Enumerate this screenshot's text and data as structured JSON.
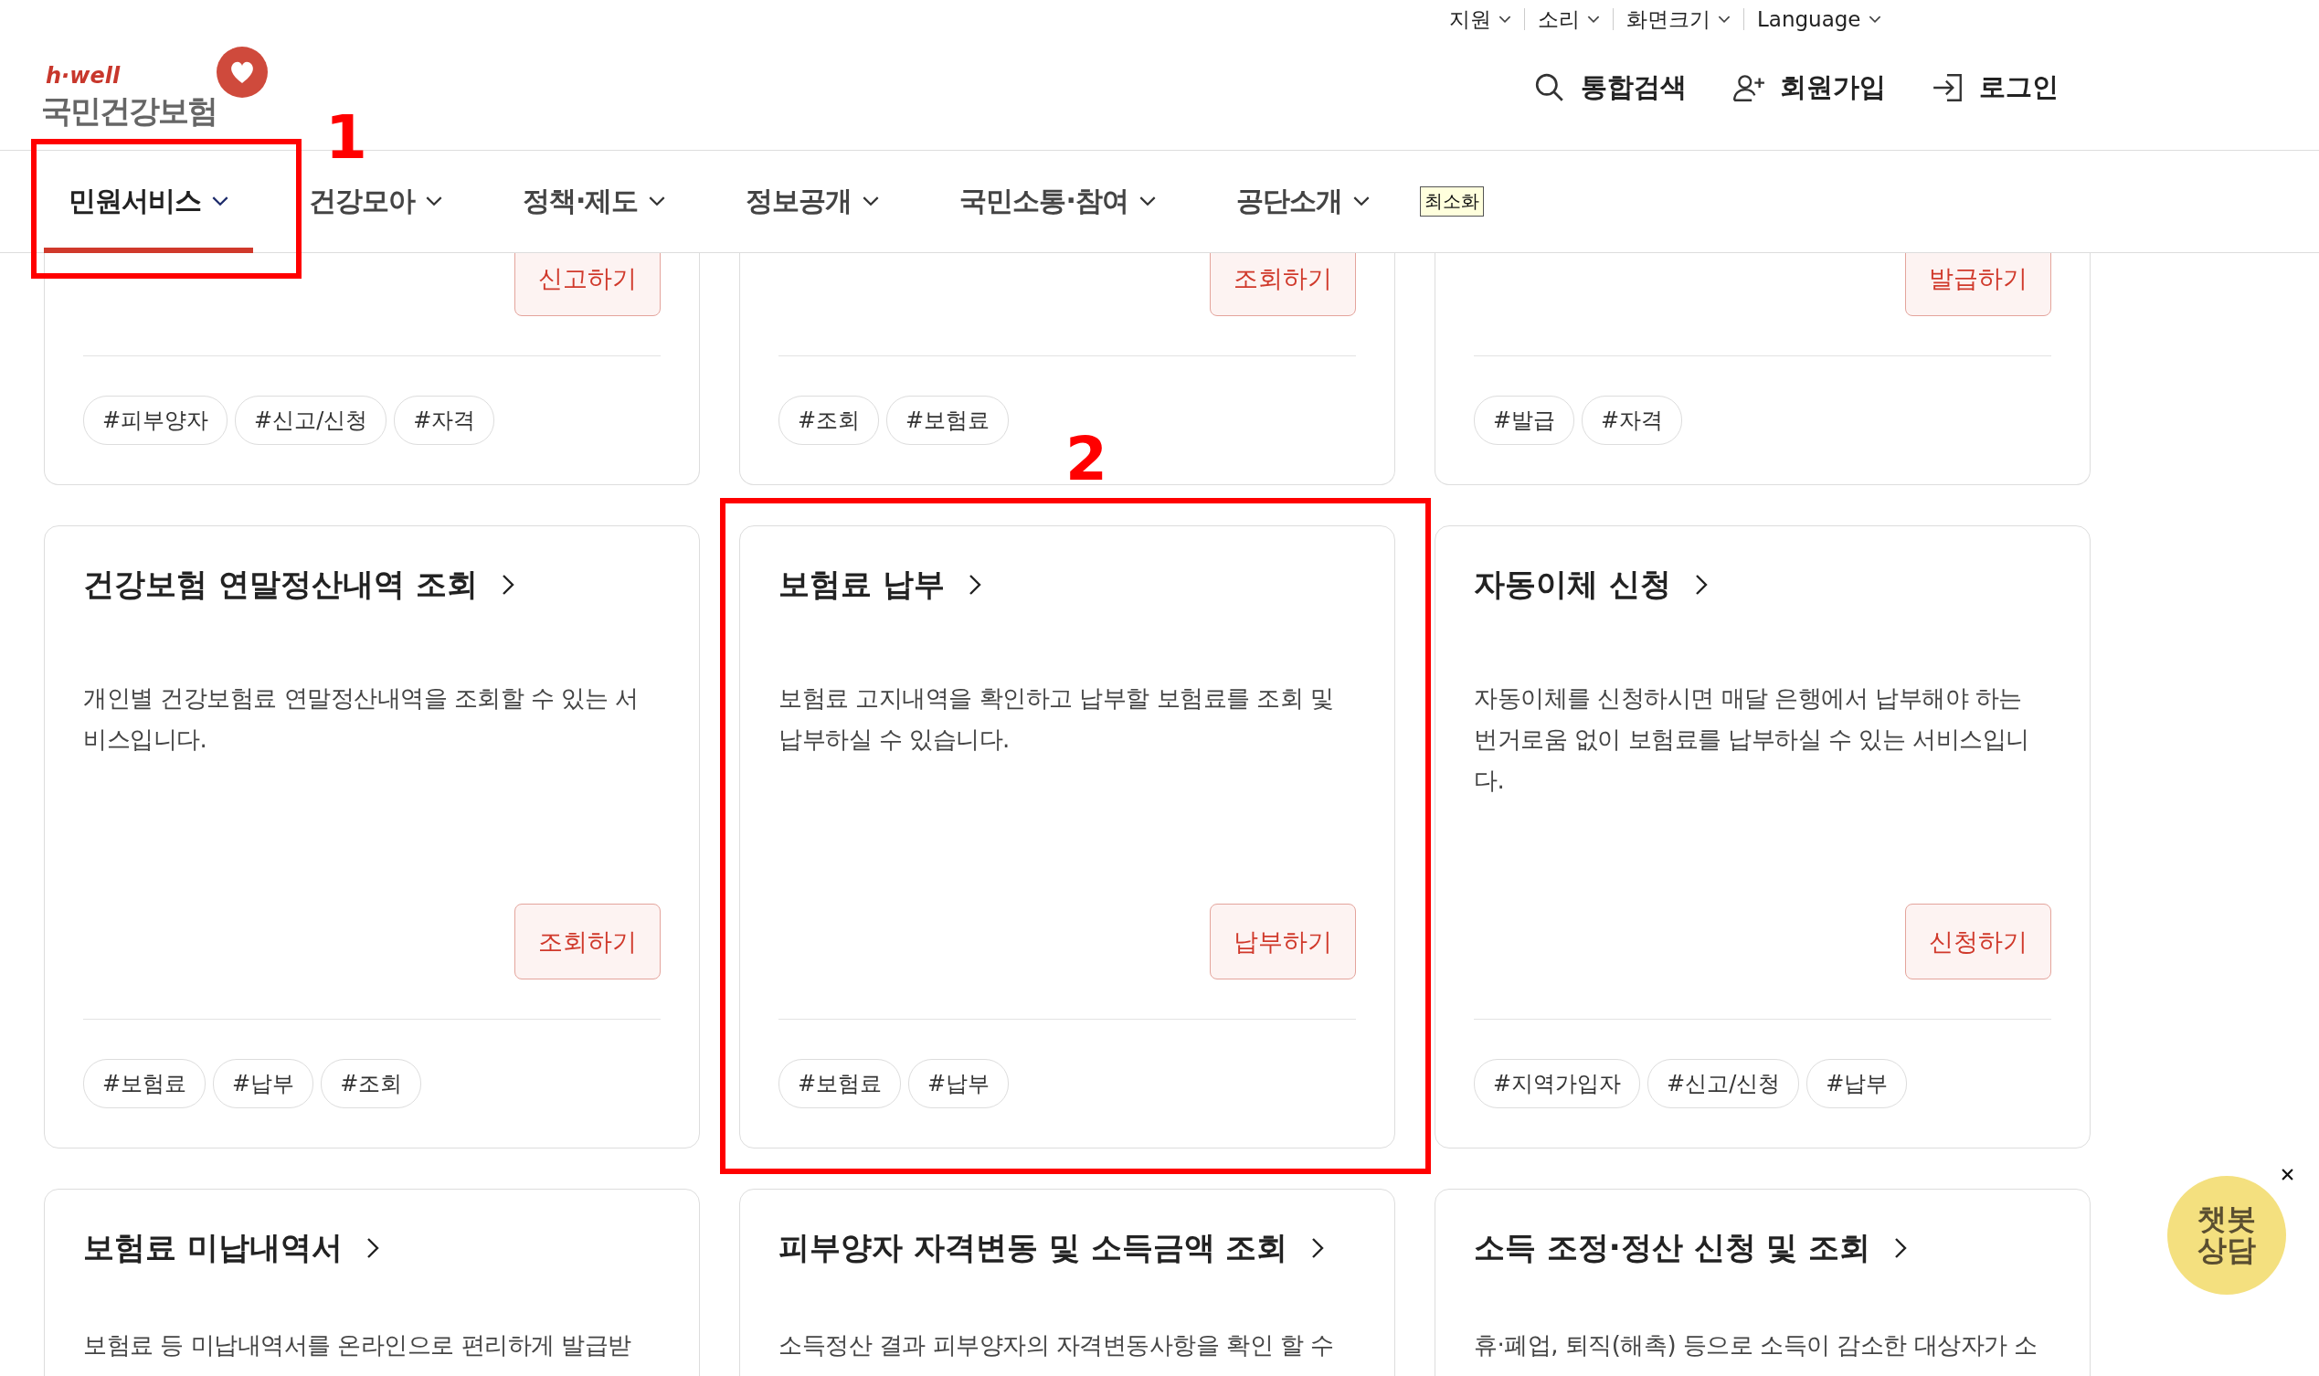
{
  "utility_menu": [
    {
      "label": "지원"
    },
    {
      "label": "소리"
    },
    {
      "label": "화면크기"
    },
    {
      "label": "Language"
    }
  ],
  "logo": {
    "tagline": "h·well",
    "name": "국민건강보험"
  },
  "header_actions": [
    {
      "kind": "search",
      "label": "통합검색"
    },
    {
      "kind": "signup",
      "label": "회원가입"
    },
    {
      "kind": "login",
      "label": "로그인"
    }
  ],
  "nav": {
    "items": [
      {
        "label": "민원서비스",
        "selected": true
      },
      {
        "label": "건강모아",
        "selected": false
      },
      {
        "label": "정책·제도",
        "selected": false
      },
      {
        "label": "정보공개",
        "selected": false
      },
      {
        "label": "국민소통·참여",
        "selected": false
      },
      {
        "label": "공단소개",
        "selected": false
      }
    ],
    "minimize": "최소화"
  },
  "card_rows": [
    {
      "kind": "tail",
      "cards": [
        {
          "button": "신고하기",
          "tags": [
            "#피부양자",
            "#신고/신청",
            "#자격"
          ]
        },
        {
          "button": "조회하기",
          "tags": [
            "#조회",
            "#보험료"
          ]
        },
        {
          "button": "발급하기",
          "tags": [
            "#발급",
            "#자격"
          ]
        }
      ]
    },
    {
      "kind": "full",
      "cards": [
        {
          "title": "건강보험 연말정산내역 조회",
          "description": "개인별 건강보험료 연말정산내역을 조회할 수 있는 서비스입니다.",
          "button": "조회하기",
          "tags": [
            "#보험료",
            "#납부",
            "#조회"
          ]
        },
        {
          "title": "보험료 납부",
          "description": "보험료 고지내역을 확인하고 납부할 보험료를 조회 및 납부하실 수 있습니다.",
          "button": "납부하기",
          "tags": [
            "#보험료",
            "#납부"
          ]
        },
        {
          "title": "자동이체 신청",
          "description": "자동이체를 신청하시면 매달 은행에서 납부해야 하는 번거로움 없이 보험료를 납부하실 수 있는 서비스입니다.",
          "button": "신청하기",
          "tags": [
            "#지역가입자",
            "#신고/신청",
            "#납부"
          ]
        }
      ]
    },
    {
      "kind": "head",
      "cards": [
        {
          "title": "보험료 미납내역서",
          "description": "보험료 등 미납내역서를 온라인으로 편리하게 발급받"
        },
        {
          "title": "피부양자 자격변동 및 소득금액 조회",
          "description": "소득정산 결과 피부양자의 자격변동사항을 확인 할 수"
        },
        {
          "title": "소득 조정·정산 신청 및 조회",
          "description": "휴·폐업, 퇴직(해촉) 등으로 소득이 감소한 대상자가 소"
        }
      ]
    }
  ],
  "annotations": [
    {
      "label": "1"
    },
    {
      "label": "2"
    }
  ],
  "chatbot": {
    "label": "챗봇 상담"
  }
}
